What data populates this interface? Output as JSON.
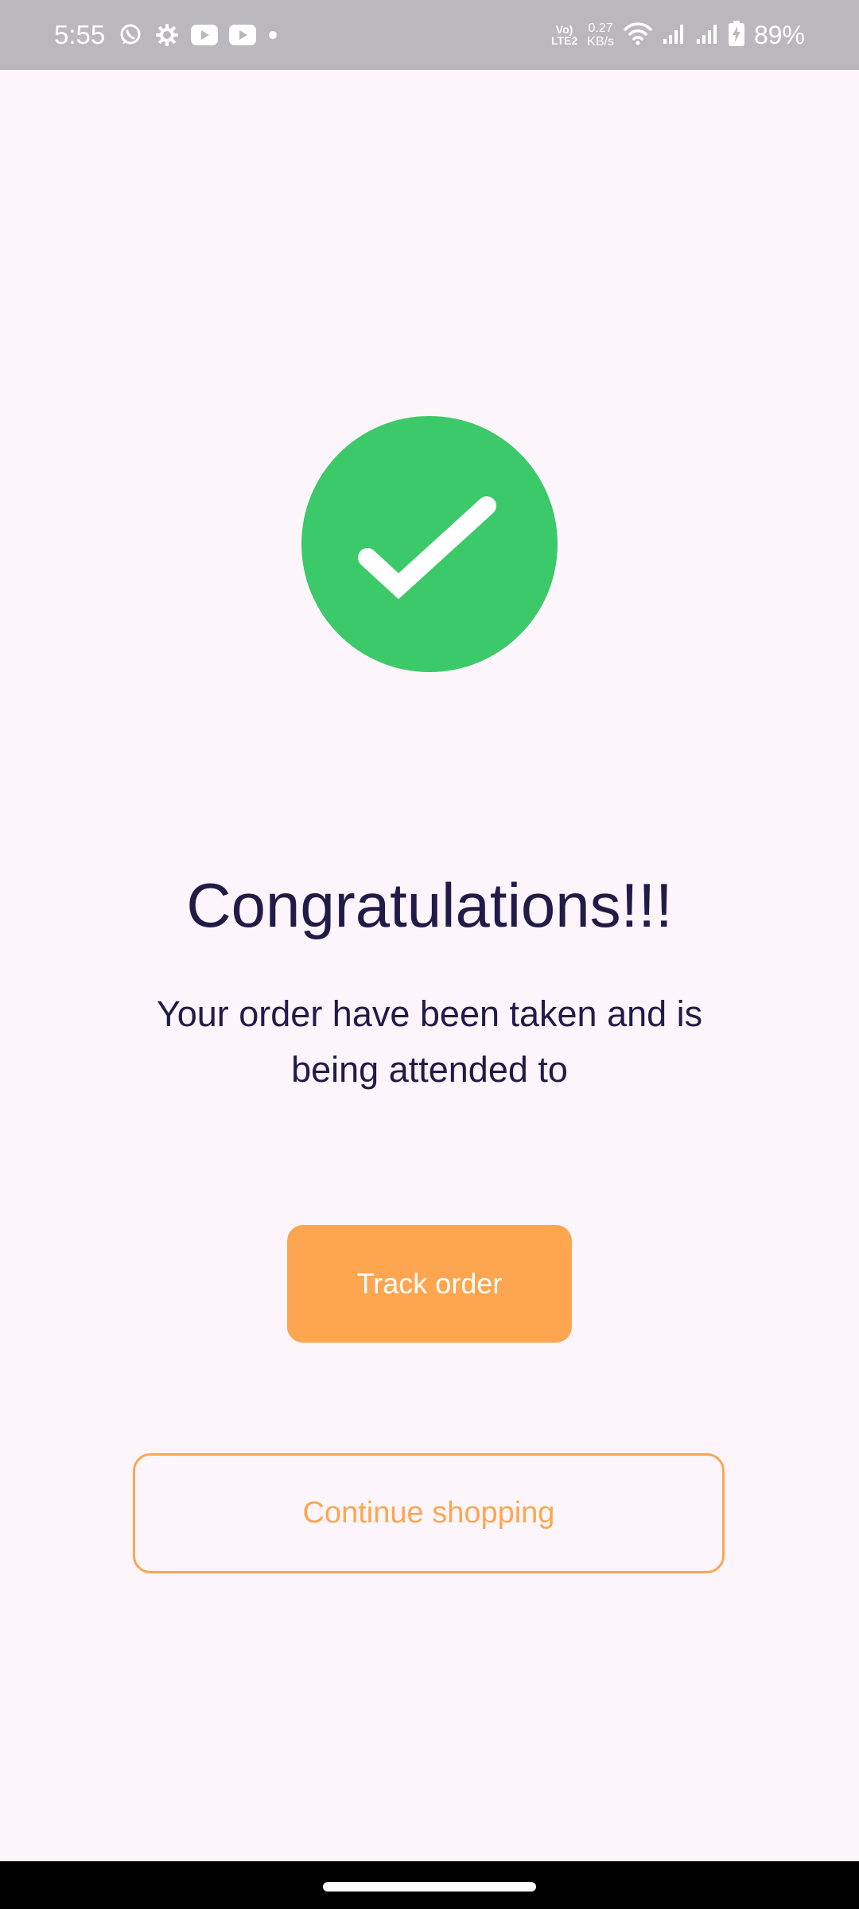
{
  "status_bar": {
    "time": "5:55",
    "volte_top": "Vo)",
    "volte_bottom": "LTE2",
    "net_speed_value": "0.27",
    "net_speed_unit": "KB/s",
    "battery_percent": "89%",
    "icons": [
      "whatsapp-icon",
      "settings-icon",
      "youtube-icon",
      "youtube-icon",
      "dot-icon",
      "wifi-icon",
      "signal-icon",
      "signal-icon",
      "battery-charging-icon"
    ]
  },
  "confirmation": {
    "icon": "checkmark-icon",
    "title": "Congratulations!!!",
    "message": "Your order have been taken and is being attended to"
  },
  "actions": {
    "track_label": "Track order",
    "continue_label": "Continue shopping"
  },
  "colors": {
    "background": "#fcf6fc",
    "success_green": "#3cc96a",
    "accent_orange": "#fea550",
    "text_dark": "#221a47"
  }
}
